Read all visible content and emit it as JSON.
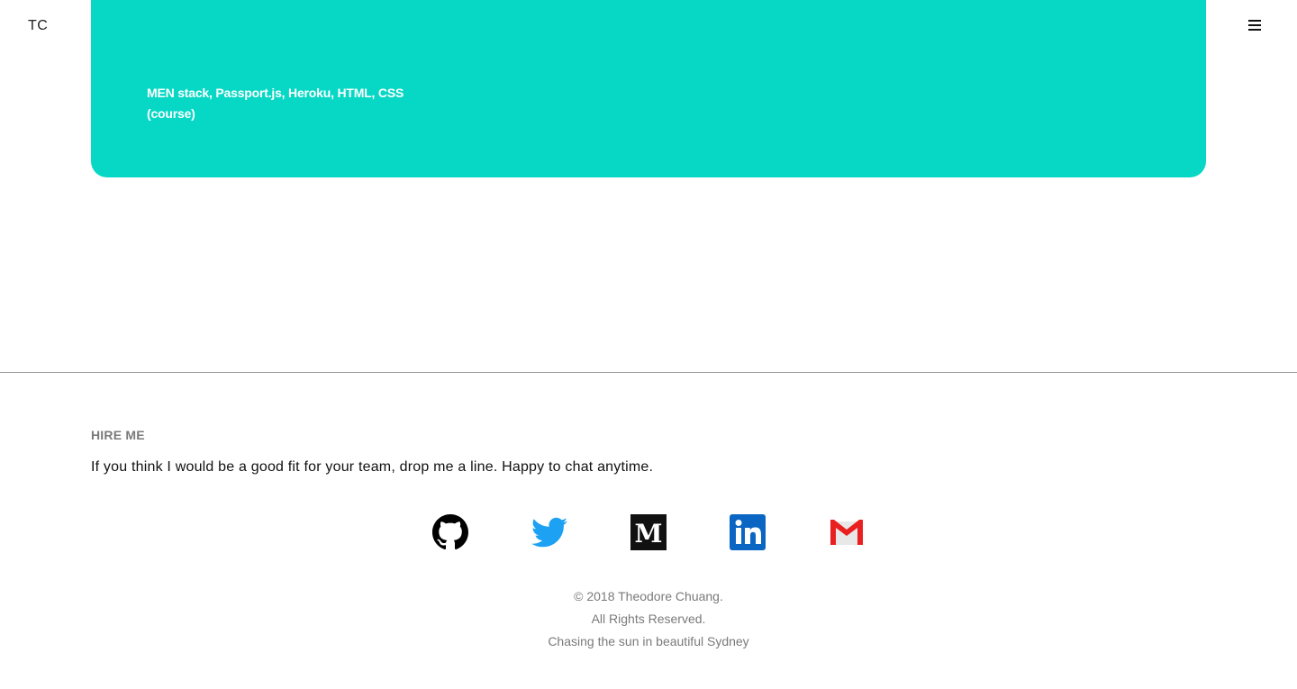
{
  "header": {
    "logo_text": "TC",
    "menu_icon": "hamburger-menu-icon"
  },
  "project_card": {
    "tech_line": "MEN stack, Passport.js, Heroku, HTML, CSS",
    "note_line": "(course)",
    "background_color": "#06d8c5"
  },
  "footer": {
    "hire_heading": "HIRE ME",
    "hire_text": "If you think I would be a good fit for your team, drop me a line. Happy to chat anytime.",
    "social_links": [
      {
        "name": "github",
        "icon": "github-icon",
        "color": "#000000"
      },
      {
        "name": "twitter",
        "icon": "twitter-icon",
        "color": "#1da1f2"
      },
      {
        "name": "medium",
        "icon": "medium-icon",
        "color": "#111111"
      },
      {
        "name": "linkedin",
        "icon": "linkedin-icon",
        "color": "#0a66c2"
      },
      {
        "name": "gmail",
        "icon": "gmail-icon",
        "color": "#ea1f1f"
      }
    ],
    "copyright": "© 2018 Theodore Chuang.",
    "rights": "All Rights Reserved.",
    "tagline": "Chasing the sun in beautiful Sydney"
  }
}
